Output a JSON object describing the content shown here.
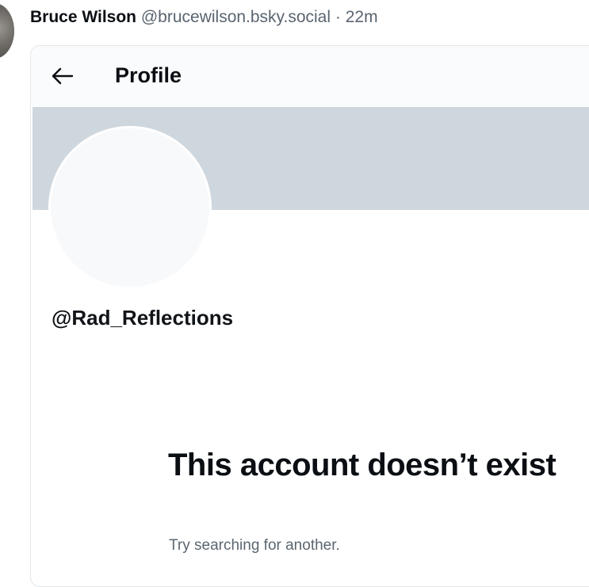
{
  "post": {
    "author_name": "Bruce Wilson",
    "author_handle": "@brucewilson.bsky.social",
    "separator": "·",
    "time": "22m"
  },
  "embed": {
    "topbar": {
      "back_icon": "arrow-left-icon",
      "title": "Profile"
    },
    "profile": {
      "handle": "@Rad_Reflections"
    },
    "notice": {
      "title": "This account doesn’t exist",
      "subtitle": "Try searching for another."
    }
  },
  "colors": {
    "banner": "#cfd7de",
    "avatar_placeholder": "#f8f9fa",
    "muted_text": "#5a6470",
    "primary_text": "#0b0f14"
  }
}
